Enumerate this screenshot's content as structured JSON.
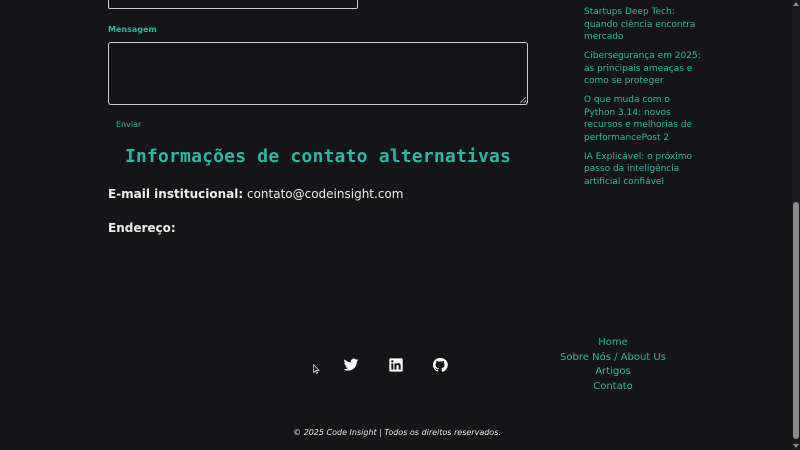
{
  "form": {
    "message_label": "Mensagem",
    "message_value": "",
    "submit_label": "Enviar"
  },
  "alt_contact": {
    "heading": "Informações de contato alternativas",
    "email_label": "E-mail institucional:",
    "email_value": "contato@codeinsight.com",
    "address_label": "Endereço:"
  },
  "sidebar": {
    "articles": [
      "Startups Deep Tech: quando ciência encontra mercado",
      "Cibersegurança em 2025: as principais ameaças e como se proteger",
      "O que muda com o Python 3.14: novos recursos e melhorias de performancePost 2",
      "IA Explicável: o próximo passo da inteligência artificial confiável"
    ]
  },
  "footer": {
    "social_icons": [
      "twitter-icon",
      "linkedin-icon",
      "github-icon"
    ],
    "nav": [
      "Home",
      "Sobre Nós / About Us",
      "Artigos",
      "Contato"
    ],
    "copyright": "© 2025 Code Insight | Todos os direitos reservados."
  },
  "colors": {
    "background": "#151517",
    "accent": "#2fb6a6",
    "text": "#ececec"
  }
}
